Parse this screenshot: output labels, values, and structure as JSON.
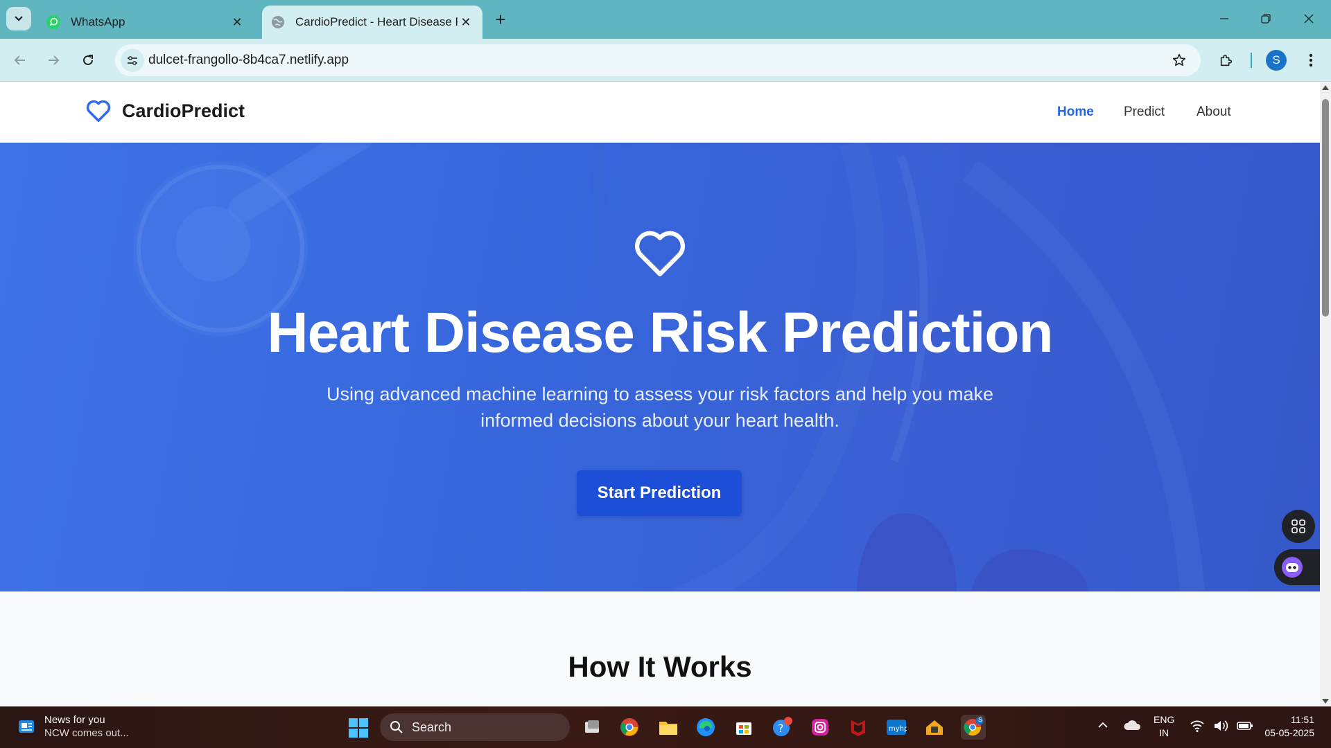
{
  "browser": {
    "tabs": [
      {
        "title": "WhatsApp",
        "active": false,
        "favicon": "whatsapp-icon"
      },
      {
        "title": "CardioPredict - Heart Disease R",
        "active": true,
        "favicon": "globe-icon"
      }
    ],
    "url": "dulcet-frangollo-8b4ca7.netlify.app",
    "profile_initial": "S",
    "accent": "#5fb6c1"
  },
  "site": {
    "brand": "CardioPredict",
    "nav": [
      {
        "label": "Home",
        "active": true
      },
      {
        "label": "Predict",
        "active": false
      },
      {
        "label": "About",
        "active": false
      }
    ]
  },
  "hero": {
    "title": "Heart Disease Risk Prediction",
    "subtitle": "Using advanced machine learning to assess your risk factors and help you make informed decisions about your heart health.",
    "cta": "Start Prediction",
    "color": "#3b6ee6",
    "cta_color": "#1d4ed8"
  },
  "how": {
    "title": "How It Works"
  },
  "taskbar": {
    "news_title": "News for you",
    "news_sub": "NCW comes out...",
    "search_label": "Search",
    "lang_line1": "ENG",
    "lang_line2": "IN",
    "time": "11:51",
    "date": "05-05-2025",
    "chrome_badge": "S"
  }
}
